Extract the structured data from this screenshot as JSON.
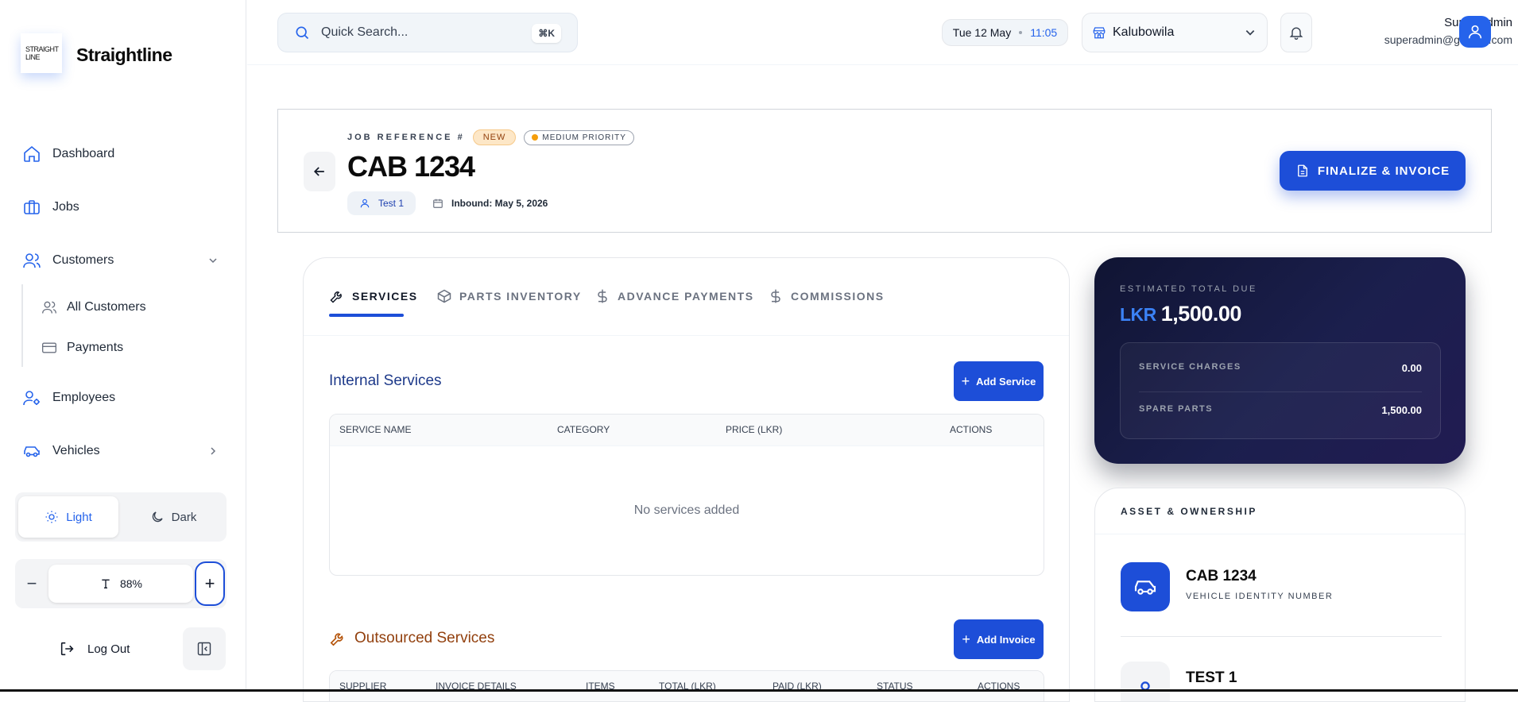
{
  "sidebar": {
    "logo_line1": "STRAIGHT",
    "logo_line2": "LINE",
    "brand": "Straightline",
    "items": {
      "dashboard": "Dashboard",
      "jobs": "Jobs",
      "customers": "Customers",
      "all_customers": "All Customers",
      "payments": "Payments",
      "employees": "Employees",
      "vehicles": "Vehicles"
    },
    "theme": {
      "light": "Light",
      "dark": "Dark"
    },
    "font_zoom": "88%",
    "logout": "Log Out"
  },
  "topbar": {
    "search_placeholder": "Quick Search...",
    "search_shortcut": "⌘K",
    "date": "Tue 12 May",
    "time": "11:05",
    "branch": "Kalubowila",
    "user_name": "Super Admin",
    "user_email": "superadmin@garage.com"
  },
  "job": {
    "ref_label": "JOB REFERENCE #",
    "status_badge": "NEW",
    "priority_badge": "MEDIUM PRIORITY",
    "title": "CAB 1234",
    "owner": "Test 1",
    "inbound": "Inbound: May 5, 2026",
    "finalize_label": "FINALIZE & INVOICE"
  },
  "tabs": [
    "SERVICES",
    "PARTS INVENTORY",
    "ADVANCE PAYMENTS",
    "COMMISSIONS"
  ],
  "internal_services": {
    "title": "Internal Services",
    "add_label": "Add Service",
    "columns": [
      "SERVICE NAME",
      "CATEGORY",
      "PRICE (LKR)",
      "ACTIONS"
    ],
    "empty": "No services added"
  },
  "outsourced_services": {
    "title": "Outsourced Services",
    "add_label": "Add Invoice",
    "columns": [
      "SUPPLIER",
      "INVOICE DETAILS",
      "ITEMS",
      "TOTAL (LKR)",
      "PAID (LKR)",
      "STATUS",
      "ACTIONS"
    ]
  },
  "summary": {
    "label": "ESTIMATED TOTAL DUE",
    "currency": "LKR",
    "total": "1,500.00",
    "service_charges_label": "SERVICE CHARGES",
    "service_charges": "0.00",
    "spare_parts_label": "SPARE PARTS",
    "spare_parts": "1,500.00"
  },
  "asset": {
    "title": "ASSET & OWNERSHIP",
    "vehicle_number": "CAB 1234",
    "vehicle_label": "VEHICLE IDENTITY NUMBER",
    "owner_name": "TEST 1"
  },
  "colors": {
    "accent": "#1d4ed8",
    "summary_bg": "#151a40",
    "badge_new": "#fde7c7",
    "priority_dot": "#f59e0b",
    "outsourced_title": "#92400e"
  }
}
